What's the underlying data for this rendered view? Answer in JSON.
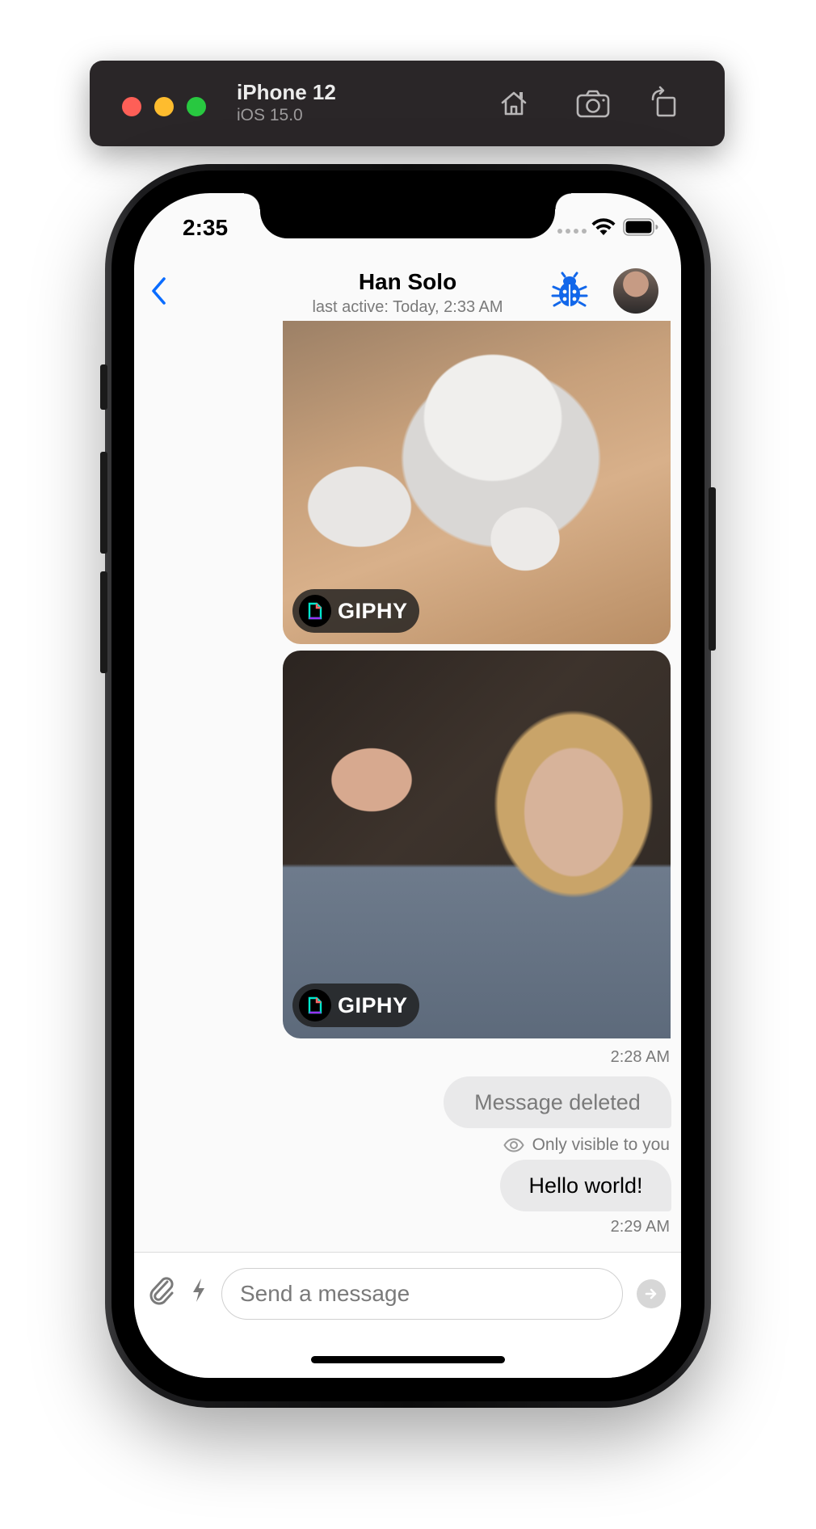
{
  "simulator": {
    "device_name": "iPhone 12",
    "os_version": "iOS 15.0",
    "buttons": [
      "home-icon",
      "screenshot-icon",
      "rotate-icon"
    ]
  },
  "status_bar": {
    "time": "2:35"
  },
  "header": {
    "title": "Han Solo",
    "subtitle": "last active: Today, 2:33 AM"
  },
  "messages": [
    {
      "type": "giphy",
      "badge_label": "GIPHY"
    },
    {
      "type": "giphy",
      "badge_label": "GIPHY",
      "timestamp": "2:28 AM"
    },
    {
      "type": "deleted",
      "text": "Message deleted",
      "note": "Only visible to you"
    },
    {
      "type": "text",
      "text": "Hello world!",
      "timestamp": "2:29 AM"
    }
  ],
  "composer": {
    "placeholder": "Send a message"
  },
  "colors": {
    "accent": "#0a6cff",
    "bubble": "#e9e9ea",
    "secondary_text": "#7a7a7a"
  }
}
